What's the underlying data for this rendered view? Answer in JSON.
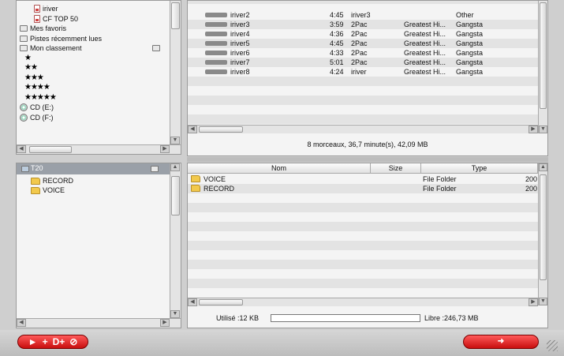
{
  "tree_top": {
    "items": [
      {
        "label": "iriver",
        "icon": "playlist-icon"
      },
      {
        "label": "CF TOP 50",
        "icon": "playlist-icon"
      },
      {
        "label": "Mes favoris",
        "icon": "folder-icon"
      },
      {
        "label": "Pistes récemment lues",
        "icon": "folder-icon"
      },
      {
        "label": "Mon classement",
        "icon": "folder-icon"
      },
      {
        "label": "★",
        "icon": "none"
      },
      {
        "label": "★★",
        "icon": "none"
      },
      {
        "label": "★★★",
        "icon": "none"
      },
      {
        "label": "★★★★",
        "icon": "none"
      },
      {
        "label": "★★★★★",
        "icon": "none"
      },
      {
        "label": "CD (E:)",
        "icon": "cd-icon"
      },
      {
        "label": "CD (F:)",
        "icon": "cd-icon"
      }
    ]
  },
  "tracks": {
    "rows": [
      {
        "title": "iriver2",
        "time": "4:45",
        "artist": "iriver3",
        "album": "",
        "genre": "Other"
      },
      {
        "title": "iriver3",
        "time": "3:59",
        "artist": "2Pac",
        "album": "Greatest Hi...",
        "genre": "Gangsta"
      },
      {
        "title": "iriver4",
        "time": "4:36",
        "artist": "2Pac",
        "album": "Greatest Hi...",
        "genre": "Gangsta"
      },
      {
        "title": "iriver5",
        "time": "4:45",
        "artist": "2Pac",
        "album": "Greatest Hi...",
        "genre": "Gangsta"
      },
      {
        "title": "iriver6",
        "time": "4:33",
        "artist": "2Pac",
        "album": "Greatest Hi...",
        "genre": "Gangsta"
      },
      {
        "title": "iriver7",
        "time": "5:01",
        "artist": "2Pac",
        "album": "Greatest Hi...",
        "genre": "Gangsta"
      },
      {
        "title": "iriver8",
        "time": "4:24",
        "artist": "iriver",
        "album": "Greatest Hi...",
        "genre": "Gangsta"
      }
    ],
    "summary": "8 morceaux, 36,7 minute(s), 42,09 MB"
  },
  "device_tree": {
    "root": "T20",
    "items": [
      "RECORD",
      "VOICE"
    ]
  },
  "files": {
    "headers": {
      "name": "Nom",
      "size": "Size",
      "type": "Type"
    },
    "rows": [
      {
        "name": "VOICE",
        "size": "",
        "type": "File Folder",
        "extra": "200"
      },
      {
        "name": "RECORD",
        "size": "",
        "type": "File Folder",
        "extra": "200"
      }
    ]
  },
  "storage": {
    "used_label": "Utilisé :12 KB",
    "free_label": "Libre :246,73 MB",
    "used_fraction": 0.0
  },
  "colors": {
    "accent_red": "#d81e1e",
    "selection_gray": "#9aa0a8"
  }
}
